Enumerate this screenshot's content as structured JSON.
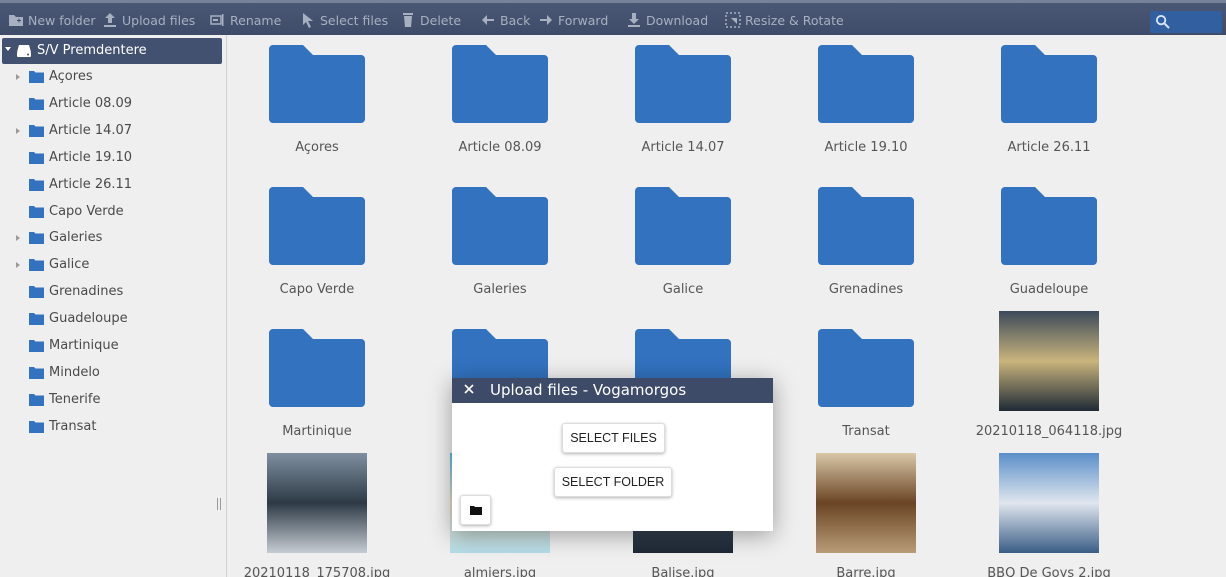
{
  "toolbar": {
    "new_folder": "New folder",
    "upload_files": "Upload files",
    "rename": "Rename",
    "select_files": "Select files",
    "delete": "Delete",
    "back": "Back",
    "forward": "Forward",
    "download": "Download",
    "resize_rotate": "Resize & Rotate",
    "search_placeholder": ""
  },
  "sidebar": {
    "root": "S/V Premdentere",
    "items": [
      {
        "label": "Açores",
        "expandable": true
      },
      {
        "label": "Article 08.09",
        "expandable": false
      },
      {
        "label": "Article 14.07",
        "expandable": true
      },
      {
        "label": "Article 19.10",
        "expandable": false
      },
      {
        "label": "Article 26.11",
        "expandable": false
      },
      {
        "label": "Capo Verde",
        "expandable": false
      },
      {
        "label": "Galeries",
        "expandable": true
      },
      {
        "label": "Galice",
        "expandable": true
      },
      {
        "label": "Grenadines",
        "expandable": false
      },
      {
        "label": "Guadeloupe",
        "expandable": false
      },
      {
        "label": "Martinique",
        "expandable": false
      },
      {
        "label": "Mindelo",
        "expandable": false
      },
      {
        "label": "Tenerife",
        "expandable": false
      },
      {
        "label": "Transat",
        "expandable": false
      }
    ]
  },
  "grid": {
    "items": [
      {
        "name": "Açores",
        "kind": "folder"
      },
      {
        "name": "Article 08.09",
        "kind": "folder"
      },
      {
        "name": "Article 14.07",
        "kind": "folder"
      },
      {
        "name": "Article 19.10",
        "kind": "folder"
      },
      {
        "name": "Article 26.11",
        "kind": "folder"
      },
      {
        "name": "Capo Verde",
        "kind": "folder"
      },
      {
        "name": "Galeries",
        "kind": "folder"
      },
      {
        "name": "Galice",
        "kind": "folder"
      },
      {
        "name": "Grenadines",
        "kind": "folder"
      },
      {
        "name": "Guadeloupe",
        "kind": "folder"
      },
      {
        "name": "Martinique",
        "kind": "folder"
      },
      {
        "name": "",
        "kind": "folder"
      },
      {
        "name": "",
        "kind": "folder"
      },
      {
        "name": "Transat",
        "kind": "folder"
      },
      {
        "name": "20210118_064118.jpg",
        "kind": "image",
        "palette": [
          "#3c4a5a",
          "#c9b47c",
          "#1f2a36"
        ]
      },
      {
        "name": "20210118_175708.jpg",
        "kind": "image",
        "palette": [
          "#7f8fa0",
          "#2d3a46",
          "#c6ccd2"
        ]
      },
      {
        "name": "almiers.jpg",
        "kind": "image",
        "palette": [
          "#5cb9d8",
          "#e9dcc4",
          "#b4dde8"
        ]
      },
      {
        "name": "Balise.jpg",
        "kind": "image",
        "palette": [
          "#2f3d4e",
          "#4e5d70",
          "#1d2733"
        ]
      },
      {
        "name": "Barre.jpg",
        "kind": "image",
        "palette": [
          "#d8c7a7",
          "#6a4424",
          "#b99d77"
        ]
      },
      {
        "name": "BBQ De Goys 2.jpg",
        "kind": "image",
        "palette": [
          "#5b8fc9",
          "#e0e6ee",
          "#3a5d86"
        ]
      }
    ]
  },
  "dialog": {
    "title": "Upload files - Vogamorgos",
    "select_files": "SELECT FILES",
    "select_folder": "SELECT FOLDER"
  },
  "colors": {
    "folder": "#3272bf",
    "toolbar": "#435170",
    "accent": "#315fa0"
  }
}
